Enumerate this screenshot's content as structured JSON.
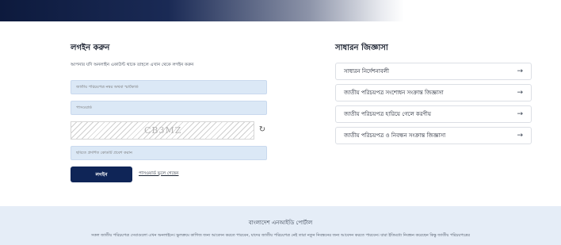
{
  "login": {
    "title": "লগইন করুন",
    "subtitle": "আপনার যদি অনলাইন একাউন্ট থাকে তাহলে এখান থেকে লগইন করুন",
    "nid_placeholder": "জাতীয় পরিচয়পত্র নম্বর অথবা স্মার্টকার্ড",
    "password_placeholder": "পাসওয়ার্ড",
    "captcha_text": "CB3MZ",
    "captcha_input_placeholder": "ছবিতে প্রদর্শিত কোডটি প্রবেশ করান",
    "submit_label": "লগইন",
    "forgot_label": "পাসওয়ার্ড ভুলে গেছেন"
  },
  "faq": {
    "title": "সাধারন জিজ্ঞাসা",
    "items": [
      "সাধারন নির্দেশনাবলী",
      "জাতীয় পরিচয়পত্র সংশোধন সংক্রান্ত জিজ্ঞাসা",
      "জাতীয় পরিচয়পত্র হারিয়ে গেলে করণীয়",
      "জাতীয় পরিচয়পত্র ও নিবন্ধন সংক্রান্ত জিজ্ঞাসা"
    ]
  },
  "footer": {
    "title": "বাংলাদেশ এনআইডি পোর্টাল",
    "text": "সকল জাতীয় পরিচয়পত্র সেবাগুলো এখন অনলাইনে। ভুলক্রমে কাগিজ জন্য আবেদন করতে পারবেন, যাদের জাতীয় পরিচয়পত্র নেই তারা নতুন নিবন্ধনের জন্য আবেদন করতে পারবেন। যারা ইতিমধ্যে নিবন্ধন করেছেন কিন্তু জাতীয় পরিচয়পত্রের"
  },
  "colors": {
    "primary": "#0f2557",
    "input_bg": "#dbe8f6",
    "footer_bg": "#e5edf7"
  }
}
